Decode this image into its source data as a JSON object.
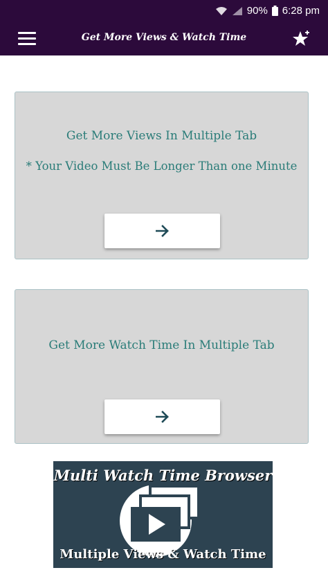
{
  "status_bar": {
    "battery_percent": "90%",
    "time": "6:28 pm"
  },
  "app_bar": {
    "title": "Get More Views & Watch Time",
    "menu_icon": "hamburger-menu-icon",
    "action_icon": "star-plus-icon"
  },
  "cards": [
    {
      "title": "Get More Views In Multiple Tab",
      "note": "* Your Video Must Be Longer Than one Minute",
      "button_icon": "arrow-right-icon"
    },
    {
      "title": "Get  More Watch Time In Multiple Tab",
      "button_icon": "arrow-right-icon"
    }
  ],
  "banner": {
    "title": "Multi Watch Time Browser",
    "subtitle": "Multiple Views & Watch Time",
    "logo_icon": "stacked-video-icon"
  },
  "colors": {
    "app_bar": "#2c0a3b",
    "card_bg": "#d7d7d7",
    "card_text": "#2a7c78",
    "arrow": "#1e4a57",
    "banner_bg": "#2d4351"
  }
}
